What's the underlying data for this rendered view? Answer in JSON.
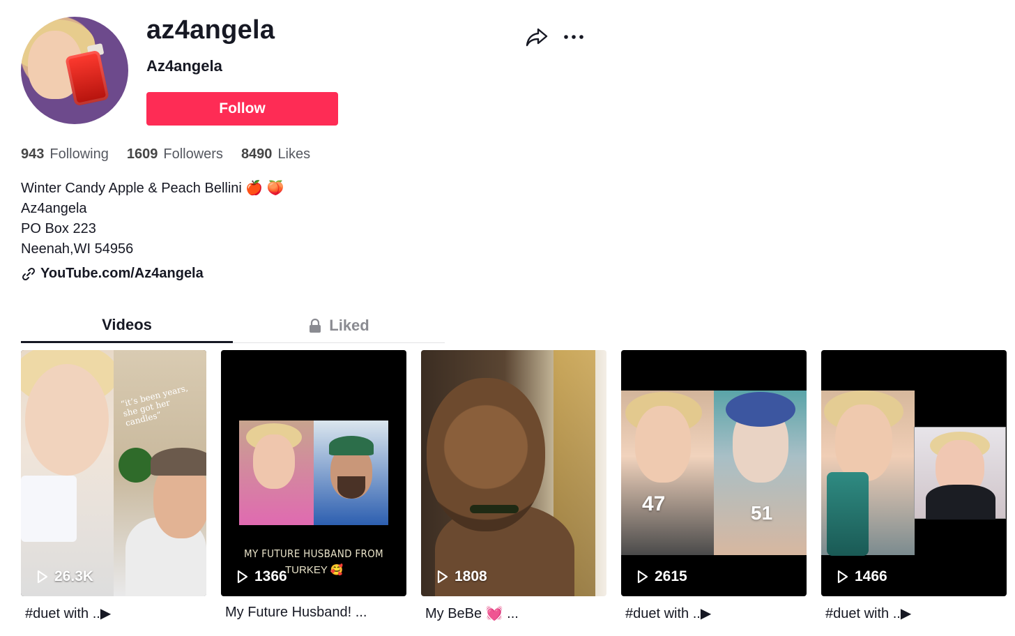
{
  "profile": {
    "username": "az4angela",
    "nickname": "Az4angela",
    "follow_label": "Follow"
  },
  "stats": [
    {
      "value": "943",
      "label": "Following"
    },
    {
      "value": "1609",
      "label": "Followers"
    },
    {
      "value": "8490",
      "label": "Likes"
    }
  ],
  "bio": {
    "lines": [
      "Winter Candy Apple & Peach Bellini 🍎 🍑",
      "Az4angela",
      "PO Box 223",
      "Neenah,WI 54956"
    ],
    "link": "YouTube.com/Az4angela"
  },
  "tabs": [
    {
      "label": "Videos",
      "active": true
    },
    {
      "label": "Liked",
      "active": false,
      "locked": true
    }
  ],
  "videos": [
    {
      "views": "26.3K",
      "caption": "#duet with ..▶",
      "overlay_text": "“it’s been years, she got her candles”"
    },
    {
      "views": "1366",
      "caption": "My Future Husband! ...",
      "overlay_text": "MY FUTURE HUSBAND  FROM",
      "overlay_text2": "TURKEY 🥰"
    },
    {
      "views": "1808",
      "caption": "My BeBe 💓 ..."
    },
    {
      "views": "2615",
      "caption": "#duet with ..▶",
      "overlay_left": "47",
      "overlay_right": "51"
    },
    {
      "views": "1466",
      "caption": "#duet with ..▶"
    }
  ],
  "icons": {
    "share": "share-icon",
    "more": "more-icon",
    "link": "link-icon",
    "lock": "lock-icon",
    "play": "play-icon"
  },
  "colors": {
    "follow_button": "#fe2c55",
    "text_primary": "#161823",
    "text_secondary": "#8a8b91"
  }
}
